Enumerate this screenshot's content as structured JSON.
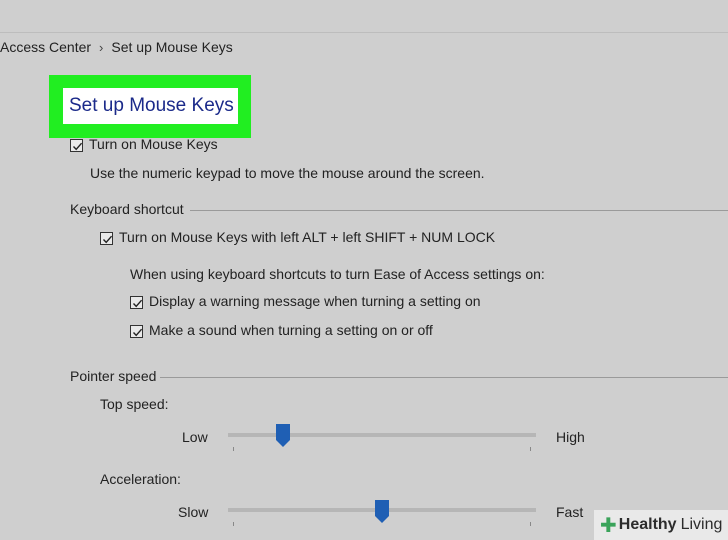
{
  "breadcrumb": {
    "parent": "Access Center",
    "current": "Set up Mouse Keys"
  },
  "page": {
    "title": "Set up Mouse Keys"
  },
  "mouse_keys": {
    "turn_on_label": "Turn on Mouse Keys",
    "turn_on_checked": true,
    "description": "Use the numeric keypad to move the mouse around the screen."
  },
  "keyboard_shortcut": {
    "group_label": "Keyboard shortcut",
    "shortcut_label": "Turn on Mouse Keys with left ALT + left SHIFT + NUM LOCK",
    "shortcut_checked": true,
    "info_text": "When using keyboard shortcuts to turn Ease of Access settings on:",
    "warning_label": "Display a warning message when turning a setting on",
    "warning_checked": true,
    "sound_label": "Make a sound when turning a setting on or off",
    "sound_checked": true
  },
  "pointer_speed": {
    "group_label": "Pointer speed",
    "top_speed": {
      "label": "Top speed:",
      "min_label": "Low",
      "max_label": "High",
      "level": 0.18
    },
    "acceleration": {
      "label": "Acceleration:",
      "min_label": "Slow",
      "max_label": "Fast",
      "level": 0.5
    }
  },
  "watermark": {
    "brand_bold": "Healthy",
    "brand_light": "Living"
  },
  "colors": {
    "highlight": "#21ee21",
    "title_text": "#1b2a8a",
    "slider_thumb": "#1f5fb4"
  }
}
